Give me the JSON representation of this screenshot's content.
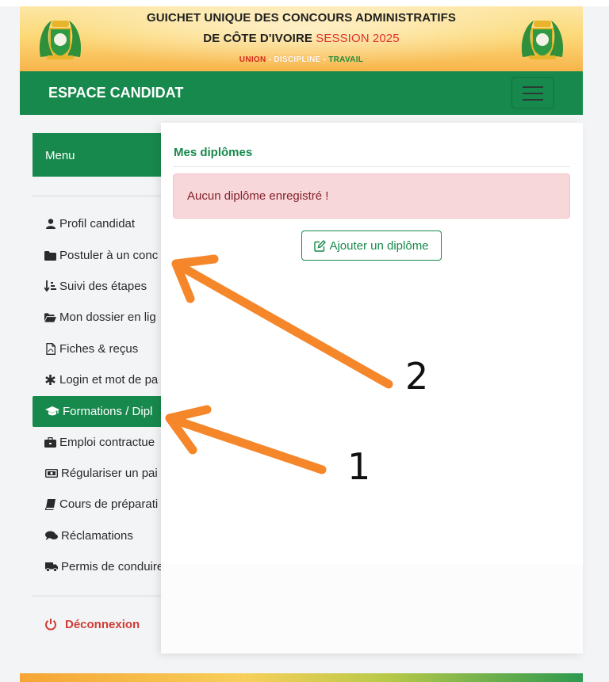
{
  "banner": {
    "title_line1": "GUICHET UNIQUE DES CONCOURS ADMINISTRATIFS",
    "title_line2": "DE CÔTE D'IVOIRE",
    "session": "SESSION 2025",
    "motto_union": "UNION",
    "motto_sep": " - ",
    "motto_discipline": "DISCIPLINE",
    "motto_travail": "TRAVAIL"
  },
  "navbar": {
    "title": "ESPACE CANDIDAT"
  },
  "sidebar": {
    "header": "Menu",
    "items": [
      {
        "label": "Profil candidat",
        "icon": "user-icon"
      },
      {
        "label": "Postuler à un conc",
        "icon": "folder-icon"
      },
      {
        "label": "Suivi des étapes",
        "icon": "sort-list-icon"
      },
      {
        "label": "Mon dossier en lig",
        "icon": "folder-open-icon"
      },
      {
        "label": "Fiches & reçus",
        "icon": "pdf-file-icon"
      },
      {
        "label": "Login et mot de pa",
        "icon": "asterisk-icon"
      },
      {
        "label": "Formations / Dipl",
        "icon": "graduation-cap-icon",
        "active": true
      },
      {
        "label": "Emploi contractue",
        "icon": "briefcase-icon"
      },
      {
        "label": "Régulariser un pai",
        "icon": "money-bill-icon"
      },
      {
        "label": "Cours de préparati",
        "icon": "book-icon"
      },
      {
        "label": "Réclamations",
        "icon": "comments-icon"
      },
      {
        "label": "Permis de conduire",
        "icon": "truck-icon"
      }
    ],
    "logout": "Déconnexion"
  },
  "main": {
    "section_title": "Mes diplômes",
    "alert_text": "Aucun diplôme enregistré !",
    "add_button": "Ajouter un diplôme"
  },
  "annotations": {
    "label_1": "1",
    "label_2": "2"
  },
  "colors": {
    "brand_green": "#17894c",
    "alert_bg": "#f7d7da",
    "alert_text": "#842029",
    "logout_red": "#d23a34",
    "arrow_orange": "#f5862a"
  }
}
